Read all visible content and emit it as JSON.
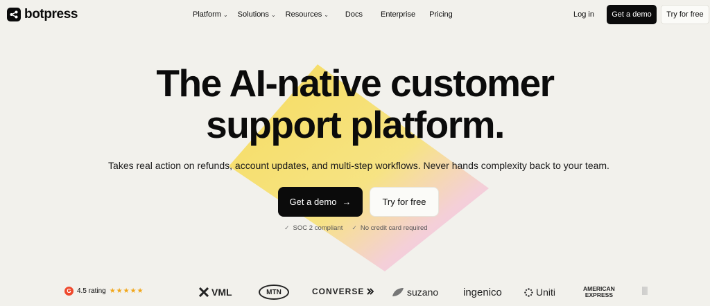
{
  "brand": {
    "name": "botpress"
  },
  "nav": {
    "items": [
      {
        "label": "Platform",
        "dropdown": true
      },
      {
        "label": "Solutions",
        "dropdown": true
      },
      {
        "label": "Resources",
        "dropdown": true
      },
      {
        "label": "Docs",
        "dropdown": false
      },
      {
        "label": "Enterprise",
        "dropdown": false
      },
      {
        "label": "Pricing",
        "dropdown": false
      }
    ],
    "login": "Log in",
    "demo": "Get a demo",
    "try": "Try for free"
  },
  "hero": {
    "line1": "The AI-native customer",
    "line2": "support platform.",
    "subtitle": "Takes real action on refunds, account updates, and multi-step workflows. Never hands complexity back to your team.",
    "cta_primary": "Get a demo",
    "cta_primary_icon": "arrow-right-icon",
    "cta_secondary": "Try for free",
    "checks": [
      "SOC 2 compliant",
      "No credit card required"
    ]
  },
  "social": {
    "rating": "4.5 rating",
    "rating_value": 4.5,
    "stars": "★★★★★",
    "g2": "G",
    "logos": {
      "vml": "VML",
      "mtn": "MTN",
      "converse": "CONVERSE",
      "suzano": "suzano",
      "ingenico": "ingenico",
      "uniti": "Uniti",
      "amex1": "AMERICAN",
      "amex2": "EXPRESS"
    }
  },
  "colors": {
    "background": "#f2f1ec",
    "primary": "#0b0b0b",
    "accent_yellow": "#f6d84a",
    "accent_pink": "#f2c2f2",
    "star": "#f1a71b",
    "g2_red": "#ef492d"
  }
}
